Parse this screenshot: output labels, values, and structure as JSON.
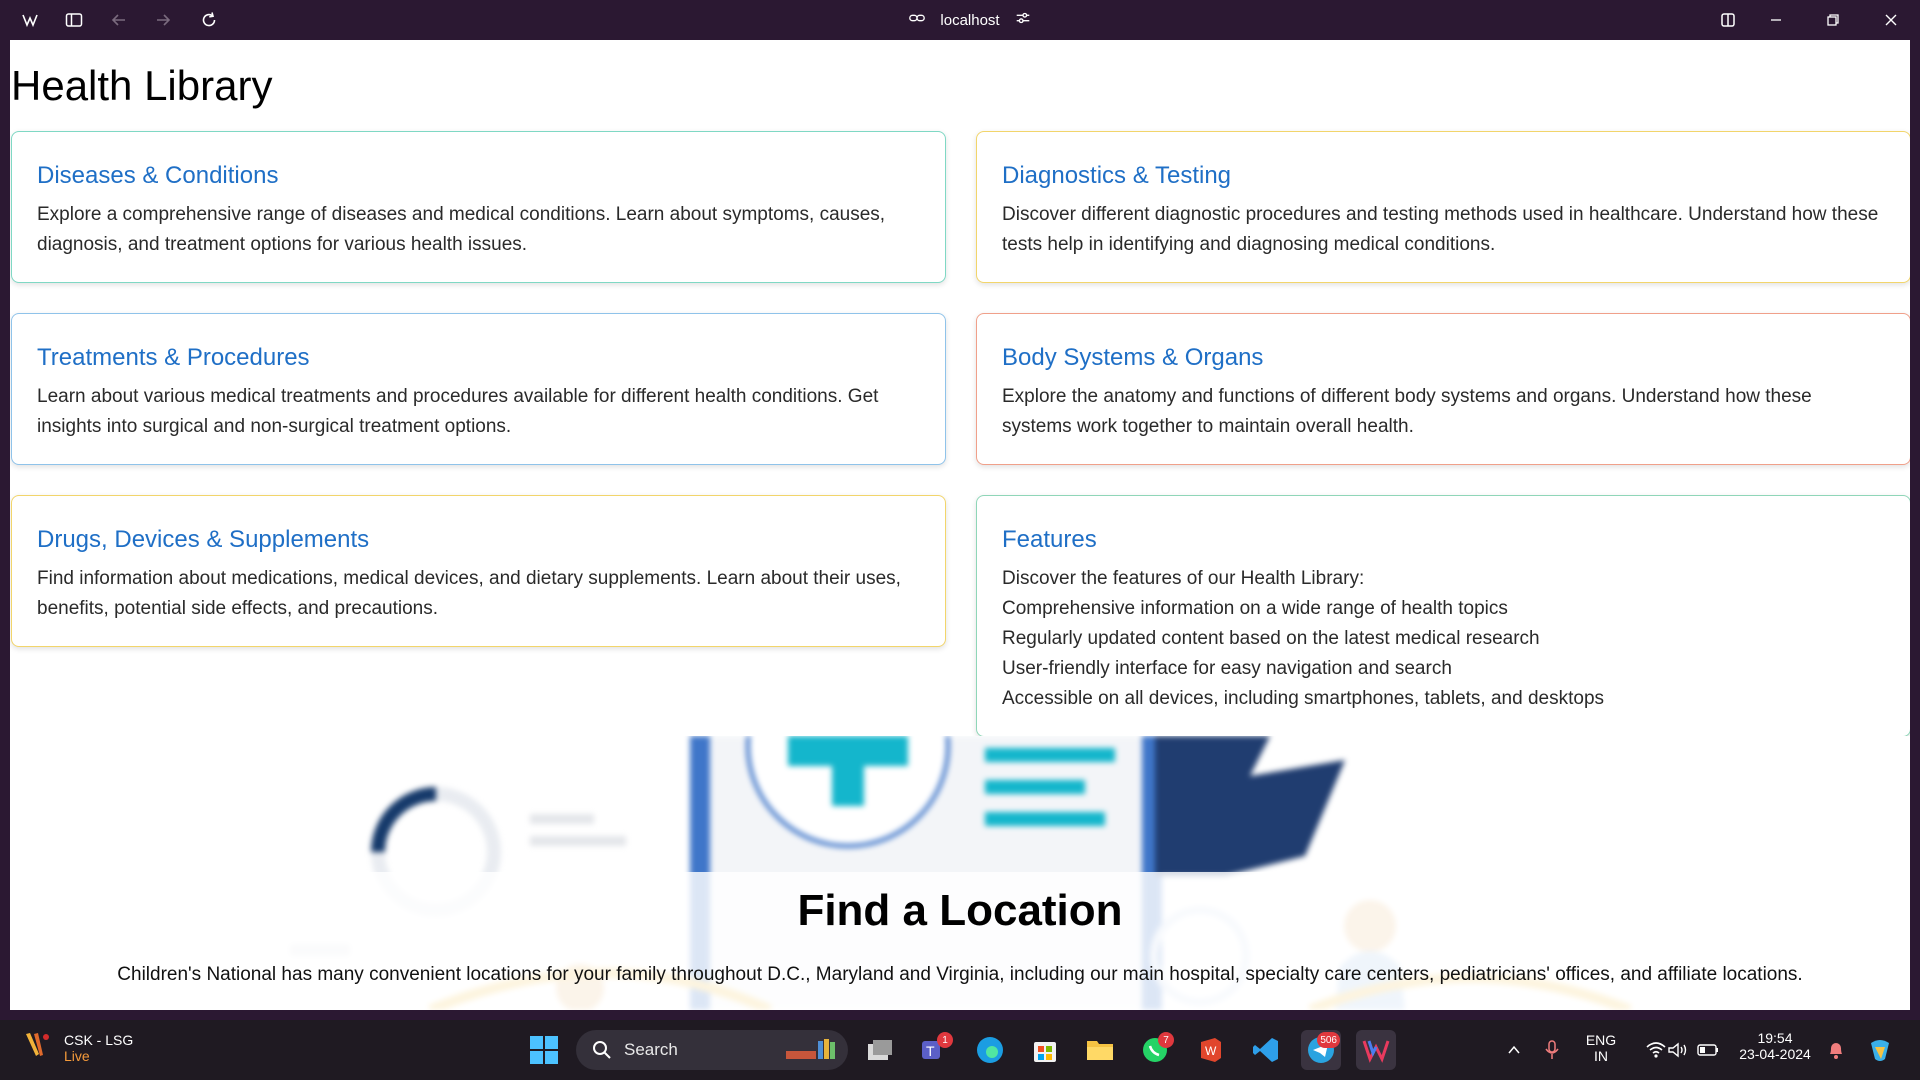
{
  "browser": {
    "url": "localhost"
  },
  "page": {
    "title": "Health Library",
    "cards": [
      {
        "title": "Diseases & Conditions",
        "text": "Explore a comprehensive range of diseases and medical conditions. Learn about symptoms, causes, diagnosis, and treatment options for various health issues.",
        "border_color": "#7fd8c4"
      },
      {
        "title": "Diagnostics & Testing",
        "text": "Discover different diagnostic procedures and testing methods used in healthcare. Understand how these tests help in identifying and diagnosing medical conditions.",
        "border_color": "#f2d56b"
      },
      {
        "title": "Treatments & Procedures",
        "text": "Learn about various medical treatments and procedures available for different health conditions. Get insights into surgical and non-surgical treatment options.",
        "border_color": "#8fc3ea"
      },
      {
        "title": "Body Systems & Organs",
        "text": "Explore the anatomy and functions of different body systems and organs. Understand how these systems work together to maintain overall health.",
        "border_color": "#f0a08a"
      },
      {
        "title": "Drugs, Devices & Supplements",
        "text": "Find information about medications, medical devices, and dietary supplements. Learn about their uses, benefits, potential side effects, and precautions.",
        "border_color": "#f2d56b"
      },
      {
        "title": "Features",
        "intro": "Discover the features of our Health Library:",
        "items": [
          "Comprehensive information on a wide range of health topics",
          "Regularly updated content based on the latest medical research",
          "User-friendly interface for easy navigation and search",
          "Accessible on all devices, including smartphones, tablets, and desktops"
        ],
        "border_color": "#8fd6b8"
      }
    ],
    "location": {
      "title": "Find a Location",
      "text": "Children's National has many convenient locations for your family throughout D.C., Maryland and Virginia, including our main hospital, specialty care centers, pediatricians' offices, and affiliate locations."
    }
  },
  "taskbar": {
    "weather_title": "CSK - LSG",
    "weather_sub": "Live",
    "search_label": "Search",
    "badges": {
      "teams": "1",
      "whatsapp": "7",
      "telegram": "506"
    },
    "lang_line1": "ENG",
    "lang_line2": "IN",
    "time": "19:54",
    "date": "23-04-2024"
  }
}
